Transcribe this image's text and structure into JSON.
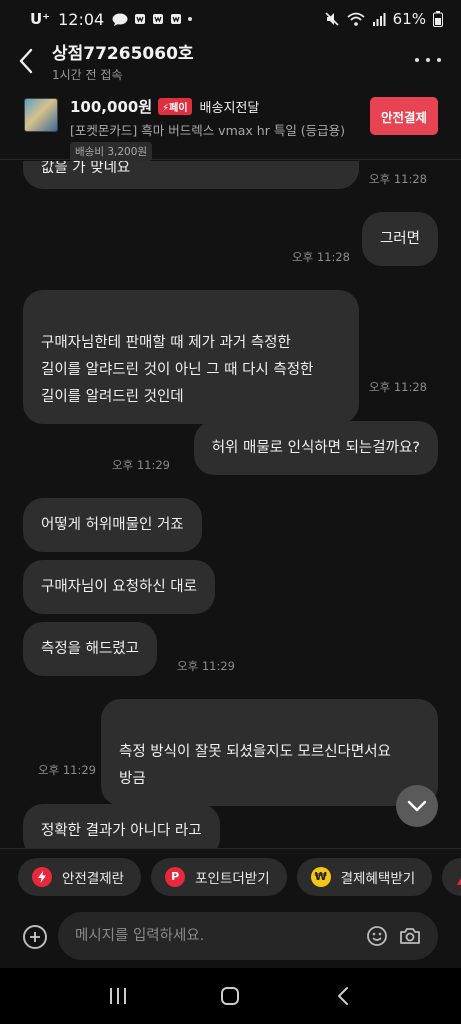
{
  "status_bar": {
    "carrier": "U⁺",
    "time": "12:04",
    "battery": "61%"
  },
  "header": {
    "title": "상점77265060호",
    "subtitle": "1시간 전 접속"
  },
  "product": {
    "price": "100,000원",
    "pay_badge": "⚡페이",
    "shipping_status": "배송지전달",
    "name": "[포켓몬카드] 흑마 버드렉스 vmax hr 특일 (등급용)",
    "shipping_fee": "배송비 3,200원",
    "safe_pay_label": "안전결제"
  },
  "messages": [
    {
      "dir": "in",
      "text": "값을 가 맞네요",
      "time": "오후 11:28"
    },
    {
      "dir": "out",
      "text": "그러면",
      "time": "오후 11:28"
    },
    {
      "dir": "in",
      "text": "구매자님한테 판매할 때 제가 과거 측정한\n길이를 알랴드린 것이 아닌 그 때 다시 측정한\n길이를 알려드린 것인데",
      "time": "오후 11:28"
    },
    {
      "dir": "out",
      "text": "허위 매물로 인식하면 되는걸까요?",
      "time": "오후 11:29"
    },
    {
      "dir": "in",
      "text": "어떻게 허위매물인 거죠",
      "time": ""
    },
    {
      "dir": "in",
      "text": "구매자님이 요청하신 대로",
      "time": ""
    },
    {
      "dir": "in",
      "text": "측정을 해드렸고",
      "time": "오후 11:29"
    },
    {
      "dir": "out",
      "text": "측정 방식이 잘못 되셨을지도 모르신다면서요\n방금",
      "time": "오후 11:29"
    },
    {
      "dir": "in",
      "text": "정확한 결과가 아니다 라고",
      "time": ""
    }
  ],
  "chips": [
    {
      "label": "안전결제란",
      "icon": "bolt-icon",
      "color": "#e8283c"
    },
    {
      "label": "포인트더받기",
      "icon": "point-icon",
      "color": "#e8283c"
    },
    {
      "label": "결제혜택받기",
      "icon": "won-coin-icon",
      "color": "#f5c518"
    },
    {
      "label": "",
      "icon": "warning-icon",
      "color": "#e8283c"
    }
  ],
  "composer": {
    "placeholder": "메시지를 입력하세요."
  }
}
